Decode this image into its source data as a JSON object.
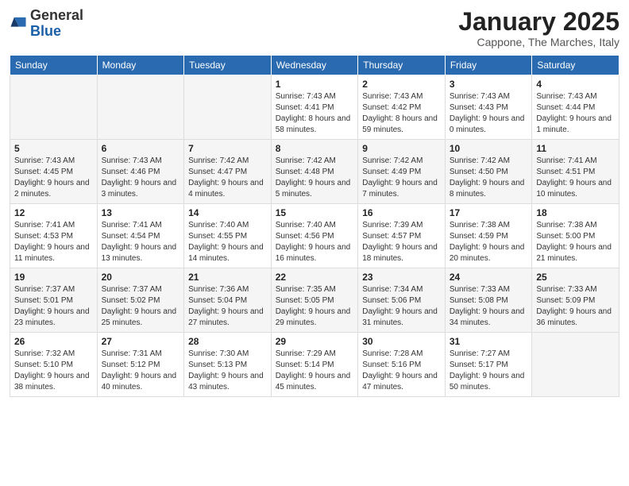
{
  "header": {
    "logo_general": "General",
    "logo_blue": "Blue",
    "month_title": "January 2025",
    "location": "Cappone, The Marches, Italy"
  },
  "days_of_week": [
    "Sunday",
    "Monday",
    "Tuesday",
    "Wednesday",
    "Thursday",
    "Friday",
    "Saturday"
  ],
  "weeks": [
    [
      {
        "day": "",
        "info": ""
      },
      {
        "day": "",
        "info": ""
      },
      {
        "day": "",
        "info": ""
      },
      {
        "day": "1",
        "info": "Sunrise: 7:43 AM\nSunset: 4:41 PM\nDaylight: 8 hours and 58 minutes."
      },
      {
        "day": "2",
        "info": "Sunrise: 7:43 AM\nSunset: 4:42 PM\nDaylight: 8 hours and 59 minutes."
      },
      {
        "day": "3",
        "info": "Sunrise: 7:43 AM\nSunset: 4:43 PM\nDaylight: 9 hours and 0 minutes."
      },
      {
        "day": "4",
        "info": "Sunrise: 7:43 AM\nSunset: 4:44 PM\nDaylight: 9 hours and 1 minute."
      }
    ],
    [
      {
        "day": "5",
        "info": "Sunrise: 7:43 AM\nSunset: 4:45 PM\nDaylight: 9 hours and 2 minutes."
      },
      {
        "day": "6",
        "info": "Sunrise: 7:43 AM\nSunset: 4:46 PM\nDaylight: 9 hours and 3 minutes."
      },
      {
        "day": "7",
        "info": "Sunrise: 7:42 AM\nSunset: 4:47 PM\nDaylight: 9 hours and 4 minutes."
      },
      {
        "day": "8",
        "info": "Sunrise: 7:42 AM\nSunset: 4:48 PM\nDaylight: 9 hours and 5 minutes."
      },
      {
        "day": "9",
        "info": "Sunrise: 7:42 AM\nSunset: 4:49 PM\nDaylight: 9 hours and 7 minutes."
      },
      {
        "day": "10",
        "info": "Sunrise: 7:42 AM\nSunset: 4:50 PM\nDaylight: 9 hours and 8 minutes."
      },
      {
        "day": "11",
        "info": "Sunrise: 7:41 AM\nSunset: 4:51 PM\nDaylight: 9 hours and 10 minutes."
      }
    ],
    [
      {
        "day": "12",
        "info": "Sunrise: 7:41 AM\nSunset: 4:53 PM\nDaylight: 9 hours and 11 minutes."
      },
      {
        "day": "13",
        "info": "Sunrise: 7:41 AM\nSunset: 4:54 PM\nDaylight: 9 hours and 13 minutes."
      },
      {
        "day": "14",
        "info": "Sunrise: 7:40 AM\nSunset: 4:55 PM\nDaylight: 9 hours and 14 minutes."
      },
      {
        "day": "15",
        "info": "Sunrise: 7:40 AM\nSunset: 4:56 PM\nDaylight: 9 hours and 16 minutes."
      },
      {
        "day": "16",
        "info": "Sunrise: 7:39 AM\nSunset: 4:57 PM\nDaylight: 9 hours and 18 minutes."
      },
      {
        "day": "17",
        "info": "Sunrise: 7:38 AM\nSunset: 4:59 PM\nDaylight: 9 hours and 20 minutes."
      },
      {
        "day": "18",
        "info": "Sunrise: 7:38 AM\nSunset: 5:00 PM\nDaylight: 9 hours and 21 minutes."
      }
    ],
    [
      {
        "day": "19",
        "info": "Sunrise: 7:37 AM\nSunset: 5:01 PM\nDaylight: 9 hours and 23 minutes."
      },
      {
        "day": "20",
        "info": "Sunrise: 7:37 AM\nSunset: 5:02 PM\nDaylight: 9 hours and 25 minutes."
      },
      {
        "day": "21",
        "info": "Sunrise: 7:36 AM\nSunset: 5:04 PM\nDaylight: 9 hours and 27 minutes."
      },
      {
        "day": "22",
        "info": "Sunrise: 7:35 AM\nSunset: 5:05 PM\nDaylight: 9 hours and 29 minutes."
      },
      {
        "day": "23",
        "info": "Sunrise: 7:34 AM\nSunset: 5:06 PM\nDaylight: 9 hours and 31 minutes."
      },
      {
        "day": "24",
        "info": "Sunrise: 7:33 AM\nSunset: 5:08 PM\nDaylight: 9 hours and 34 minutes."
      },
      {
        "day": "25",
        "info": "Sunrise: 7:33 AM\nSunset: 5:09 PM\nDaylight: 9 hours and 36 minutes."
      }
    ],
    [
      {
        "day": "26",
        "info": "Sunrise: 7:32 AM\nSunset: 5:10 PM\nDaylight: 9 hours and 38 minutes."
      },
      {
        "day": "27",
        "info": "Sunrise: 7:31 AM\nSunset: 5:12 PM\nDaylight: 9 hours and 40 minutes."
      },
      {
        "day": "28",
        "info": "Sunrise: 7:30 AM\nSunset: 5:13 PM\nDaylight: 9 hours and 43 minutes."
      },
      {
        "day": "29",
        "info": "Sunrise: 7:29 AM\nSunset: 5:14 PM\nDaylight: 9 hours and 45 minutes."
      },
      {
        "day": "30",
        "info": "Sunrise: 7:28 AM\nSunset: 5:16 PM\nDaylight: 9 hours and 47 minutes."
      },
      {
        "day": "31",
        "info": "Sunrise: 7:27 AM\nSunset: 5:17 PM\nDaylight: 9 hours and 50 minutes."
      },
      {
        "day": "",
        "info": ""
      }
    ]
  ]
}
